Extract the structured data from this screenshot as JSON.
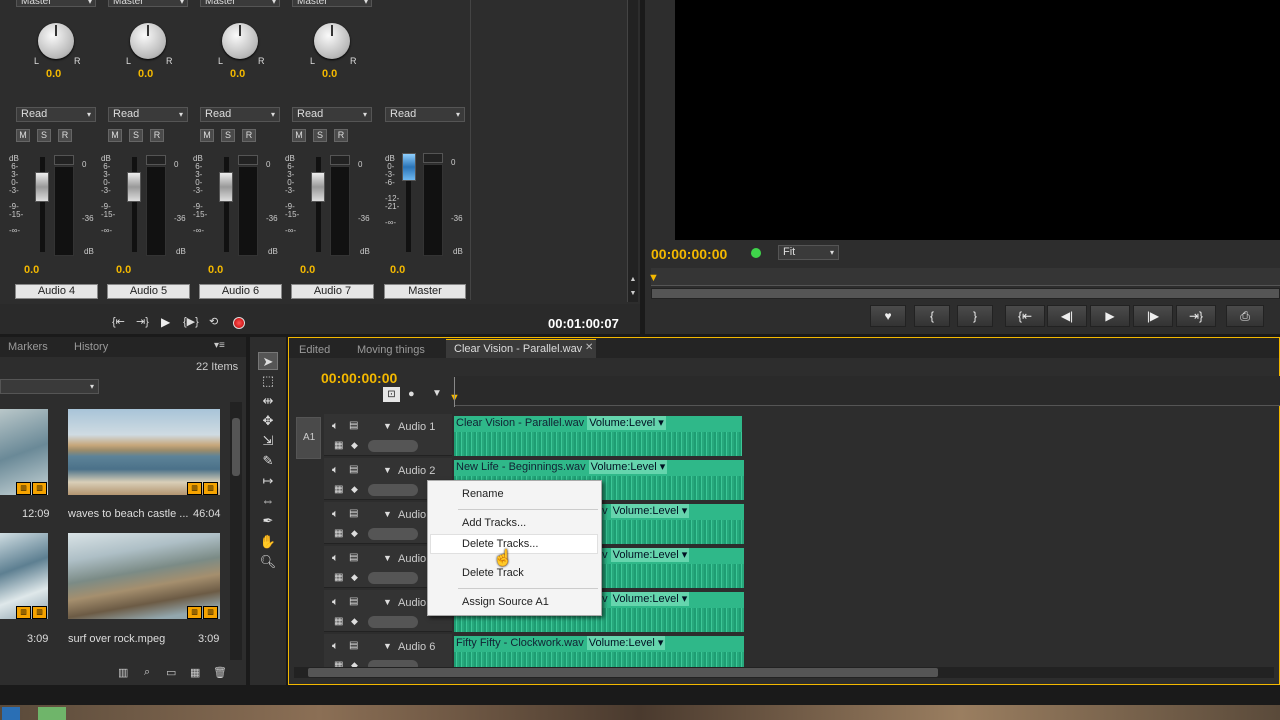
{
  "mixer": {
    "channels": [
      {
        "name": "Audio 4",
        "automation": "Read",
        "pan": "0.0",
        "level": "0.0",
        "output": "Master"
      },
      {
        "name": "Audio 5",
        "automation": "Read",
        "pan": "0.0",
        "level": "0.0",
        "output": "Master"
      },
      {
        "name": "Audio 6",
        "automation": "Read",
        "pan": "0.0",
        "level": "0.0",
        "output": "Master"
      },
      {
        "name": "Audio 7",
        "automation": "Read",
        "pan": "0.0",
        "level": "0.0",
        "output": "Master"
      }
    ],
    "master": {
      "name": "Master",
      "automation": "Read",
      "level": "0.0"
    },
    "pan_l": "L",
    "pan_r": "R",
    "mute": "M",
    "solo": "S",
    "record": "R",
    "db_label": "dB",
    "channel_scale": "dB\n 6-\n 3-\n 0-\n-3-\n\n-9-\n-15-\n\n-∞-",
    "master_scale": "dB\n 0-\n-3-\n-6-\n\n-12-\n-21-\n\n-∞-",
    "meter_top": "0",
    "meter_mid": "-36",
    "timecode": "00:01:00:07"
  },
  "program": {
    "timecode": "00:00:00:00",
    "fit": "Fit"
  },
  "project": {
    "tabs": [
      "Markers",
      "History"
    ],
    "item_count": "22 Items",
    "items": [
      {
        "name": "",
        "duration": "12:09"
      },
      {
        "name": "waves to beach castle ...",
        "duration": "46:04"
      },
      {
        "name": "",
        "duration": "3:09"
      },
      {
        "name": "surf over rock.mpeg",
        "duration": "3:09"
      }
    ]
  },
  "timeline": {
    "tabs": [
      "Edited",
      "Moving things",
      "Clear Vision - Parallel.wav"
    ],
    "timecode": "00:00:00:00",
    "source_patch": "A1",
    "tracks": [
      "Audio 1",
      "Audio 2",
      "Audio 3",
      "Audio 4",
      "Audio 5",
      "Audio 6"
    ],
    "clips": [
      {
        "name": "Clear Vision - Parallel.wav",
        "volume": "Volume:Level"
      },
      {
        "name": "New Life - Beginnings.wav",
        "volume": "Volume:Level"
      },
      {
        "name": "",
        "volume": "Volume:Level"
      },
      {
        "name": "",
        "volume": "Volume:Level"
      },
      {
        "name": "",
        "volume": "Volume:Level"
      },
      {
        "name": "Fifty Fifty - Clockwork.wav",
        "volume": "Volume:Level"
      }
    ],
    "clip_fragments": [
      "av",
      "av",
      "av"
    ]
  },
  "context_menu": {
    "items": [
      "Rename",
      "Add Tracks...",
      "Delete Tracks...",
      "Delete Track",
      "Assign Source A1"
    ]
  }
}
